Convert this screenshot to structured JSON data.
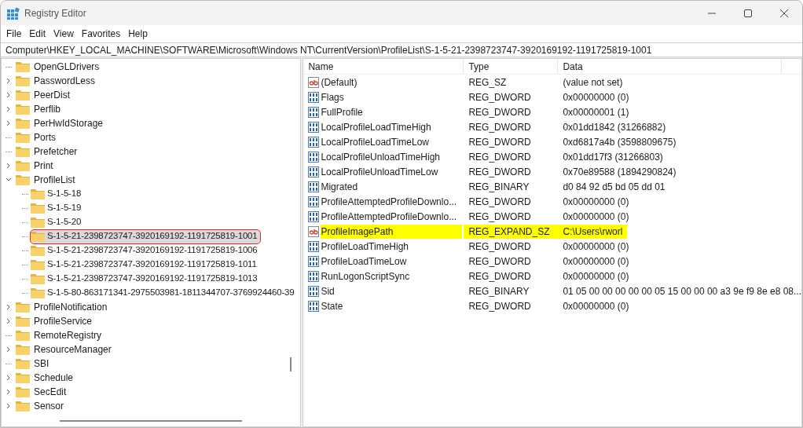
{
  "window": {
    "title": "Registry Editor"
  },
  "menu": [
    "File",
    "Edit",
    "View",
    "Favorites",
    "Help"
  ],
  "address": "Computer\\HKEY_LOCAL_MACHINE\\SOFTWARE\\Microsoft\\Windows NT\\CurrentVersion\\ProfileList\\S-1-5-21-2398723747-3920169192-1191725819-1001",
  "tree": [
    {
      "label": "OpenGLDrivers",
      "expandable": false,
      "selected": false
    },
    {
      "label": "PasswordLess",
      "expandable": true,
      "expanded": false,
      "selected": false
    },
    {
      "label": "PeerDist",
      "expandable": true,
      "expanded": false,
      "selected": false
    },
    {
      "label": "Perflib",
      "expandable": true,
      "expanded": false,
      "selected": false
    },
    {
      "label": "PerHwIdStorage",
      "expandable": true,
      "expanded": false,
      "selected": false
    },
    {
      "label": "Ports",
      "expandable": false,
      "selected": false
    },
    {
      "label": "Prefetcher",
      "expandable": false,
      "selected": false
    },
    {
      "label": "Print",
      "expandable": true,
      "expanded": false,
      "selected": false
    },
    {
      "label": "ProfileList",
      "expandable": true,
      "expanded": true,
      "selected": false,
      "children": [
        {
          "label": "S-1-5-18",
          "selected": false,
          "circled": false
        },
        {
          "label": "S-1-5-19",
          "selected": false,
          "circled": false
        },
        {
          "label": "S-1-5-20",
          "selected": false,
          "circled": false
        },
        {
          "label": "S-1-5-21-2398723747-3920169192-1191725819-1001",
          "selected": true,
          "circled": true
        },
        {
          "label": "S-1-5-21-2398723747-3920169192-1191725819-1006",
          "selected": false,
          "circled": false
        },
        {
          "label": "S-1-5-21-2398723747-3920169192-1191725819-1011",
          "selected": false,
          "circled": false
        },
        {
          "label": "S-1-5-21-2398723747-3920169192-1191725819-1013",
          "selected": false,
          "circled": false
        },
        {
          "label": "S-1-5-80-863171341-2975503981-1811344707-3769924460-39",
          "selected": false,
          "circled": false
        }
      ]
    },
    {
      "label": "ProfileNotification",
      "expandable": true,
      "expanded": false,
      "selected": false
    },
    {
      "label": "ProfileService",
      "expandable": true,
      "expanded": false,
      "selected": false
    },
    {
      "label": "RemoteRegistry",
      "expandable": false,
      "selected": false
    },
    {
      "label": "ResourceManager",
      "expandable": true,
      "expanded": false,
      "selected": false
    },
    {
      "label": "SBI",
      "expandable": false,
      "selected": false
    },
    {
      "label": "Schedule",
      "expandable": true,
      "expanded": false,
      "selected": false
    },
    {
      "label": "SecEdit",
      "expandable": true,
      "expanded": false,
      "selected": false
    },
    {
      "label": "Sensor",
      "expandable": true,
      "expanded": false,
      "selected": false
    }
  ],
  "values": {
    "columns": [
      "Name",
      "Type",
      "Data"
    ],
    "rows": [
      {
        "kind": "string",
        "name": "(Default)",
        "type": "REG_SZ",
        "data": "(value not set)",
        "highlighted": false
      },
      {
        "kind": "binary",
        "name": "Flags",
        "type": "REG_DWORD",
        "data": "0x00000000 (0)",
        "highlighted": false
      },
      {
        "kind": "binary",
        "name": "FullProfile",
        "type": "REG_DWORD",
        "data": "0x00000001 (1)",
        "highlighted": false
      },
      {
        "kind": "binary",
        "name": "LocalProfileLoadTimeHigh",
        "type": "REG_DWORD",
        "data": "0x01dd1842 (31266882)",
        "highlighted": false
      },
      {
        "kind": "binary",
        "name": "LocalProfileLoadTimeLow",
        "type": "REG_DWORD",
        "data": "0xd6817a4b (3598809675)",
        "highlighted": false
      },
      {
        "kind": "binary",
        "name": "LocalProfileUnloadTimeHigh",
        "type": "REG_DWORD",
        "data": "0x01dd17f3 (31266803)",
        "highlighted": false
      },
      {
        "kind": "binary",
        "name": "LocalProfileUnloadTimeLow",
        "type": "REG_DWORD",
        "data": "0x70e89588 (1894290824)",
        "highlighted": false
      },
      {
        "kind": "binary",
        "name": "Migrated",
        "type": "REG_BINARY",
        "data": "d0 84 92 d5 bd 05 dd 01",
        "highlighted": false
      },
      {
        "kind": "binary",
        "name": "ProfileAttemptedProfileDownlo...",
        "type": "REG_DWORD",
        "data": "0x00000000 (0)",
        "highlighted": false
      },
      {
        "kind": "binary",
        "name": "ProfileAttemptedProfileDownlo...",
        "type": "REG_DWORD",
        "data": "0x00000000 (0)",
        "highlighted": false
      },
      {
        "kind": "string",
        "name": "ProfileImagePath",
        "type": "REG_EXPAND_SZ",
        "data": "C:\\Users\\rworl",
        "highlighted": true
      },
      {
        "kind": "binary",
        "name": "ProfileLoadTimeHigh",
        "type": "REG_DWORD",
        "data": "0x00000000 (0)",
        "highlighted": false
      },
      {
        "kind": "binary",
        "name": "ProfileLoadTimeLow",
        "type": "REG_DWORD",
        "data": "0x00000000 (0)",
        "highlighted": false
      },
      {
        "kind": "binary",
        "name": "RunLogonScriptSync",
        "type": "REG_DWORD",
        "data": "0x00000000 (0)",
        "highlighted": false
      },
      {
        "kind": "binary",
        "name": "Sid",
        "type": "REG_BINARY",
        "data": "01 05 00 00 00 00 00 05 15 00 00 00 a3 9e f9 8e e8 08...",
        "highlighted": false
      },
      {
        "kind": "binary",
        "name": "State",
        "type": "REG_DWORD",
        "data": "0x00000000 (0)",
        "highlighted": false
      }
    ]
  }
}
